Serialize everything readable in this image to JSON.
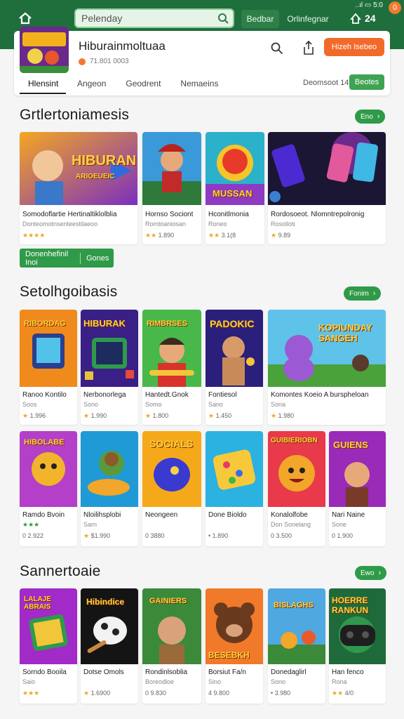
{
  "topbar": {
    "search_value": "Pelenday",
    "btn_primary": "Bedbar",
    "btn_secondary": "Orlinfegnar",
    "status_text": "..ıl ▭ 5:0",
    "badge": "0",
    "count": "24"
  },
  "app": {
    "title": "Hiburainmoltuaa",
    "rating_text": "71.801 0003",
    "install_label": "Hizeh Isebeo",
    "tabs": [
      "Hlensint",
      "Angeon",
      "Geodrent",
      "Nemaeins"
    ],
    "sort_label": "Deomsoot 14",
    "sort_button": "Beotes"
  },
  "sections": [
    {
      "title": "Grtlertoniamesis",
      "more": "Eno",
      "cards": [
        {
          "title": "Somodoflartie Hertinaltiklolblia",
          "subtitle": "Donteomotnsenteestilaeoo",
          "rating": "★★★★",
          "extra": ""
        },
        {
          "title": "Hornso Sociont",
          "subtitle": "Romtoaniosan",
          "rating": "★★",
          "extra": "1.890"
        },
        {
          "title": "Hconitlmonia",
          "subtitle": "Roneo",
          "rating": "★★",
          "extra": "3.1(8"
        },
        {
          "title": "Rordosoeot. Nlomntrepolronig",
          "subtitle": "Rosolloti",
          "rating": "★",
          "extra": "9.89"
        }
      ]
    },
    {
      "title": "Setolhgoibasis",
      "more": "Fonim",
      "cards": [
        {
          "title": "Ranoo Kontilo",
          "subtitle": "Soos",
          "rating": "★",
          "extra": "1.996"
        },
        {
          "title": "Nerbonorlega",
          "subtitle": "Sono",
          "rating": "★",
          "extra": "1.990"
        },
        {
          "title": "Hantedt.Gnok",
          "subtitle": "Somo",
          "rating": "★",
          "extra": "1.800"
        },
        {
          "title": "Fontiesol",
          "subtitle": "Sano",
          "rating": "★",
          "extra": "1.450"
        },
        {
          "title": "Komontes Koeio A burspheloan",
          "subtitle": "Sona",
          "rating": "★",
          "extra": "1.980"
        },
        {
          "title": "Ramdo Bvoin",
          "subtitle": "",
          "rating": "★★★",
          "extra": "0 2.922"
        },
        {
          "title": "Nloilihsplobi",
          "subtitle": "Sarn",
          "rating": "★",
          "extra": "$1.990"
        },
        {
          "title": "Neongeen",
          "subtitle": "",
          "rating": "",
          "extra": "0 3880"
        },
        {
          "title": "Done Bioldo",
          "subtitle": "",
          "rating": "",
          "extra": "• 1.890"
        },
        {
          "title": "Konalolfobe",
          "subtitle": "Don Sonelang",
          "rating": "",
          "extra": "0 3.500"
        },
        {
          "title": "Nari Naine",
          "subtitle": "Sone",
          "rating": "",
          "extra": "0 1.900"
        }
      ]
    },
    {
      "title": "Sannertoaie",
      "more": "Ewo",
      "cards": [
        {
          "title": "Sorndo Booila",
          "subtitle": "Saio",
          "rating": "★★★",
          "extra": ""
        },
        {
          "title": "Dotse Omols",
          "subtitle": "",
          "rating": "★",
          "extra": "1.6900"
        },
        {
          "title": "Rondinlsoblia",
          "subtitle": "Boreodloe",
          "rating": "",
          "extra": "0 9.830"
        },
        {
          "title": "Borsiut Fa/n",
          "subtitle": "Sino",
          "rating": "",
          "extra": "4 9.800"
        },
        {
          "title": "Donedaglirl",
          "subtitle": "Sono",
          "rating": "",
          "extra": "• 3.980"
        },
        {
          "title": "Han fenco",
          "subtitle": "Rona",
          "rating": "★★",
          "extra": "4/0"
        }
      ]
    }
  ],
  "row_button": {
    "left": "Donenhefinil Inoi",
    "right": "Gones"
  },
  "art": {
    "a1": "HIBURAN",
    "a1b": "ARIOEUEIC",
    "a3": "MUSSAN",
    "b1": "RIBORDAG",
    "b2": "HIBURAK",
    "b3": "RIMBRSES",
    "b4": "PADOKIC",
    "b5": "KOPIUNDAY SANGEH",
    "c1": "HIBOLABE",
    "c3": "SOCIALS",
    "c5": "GUIBIERIOBN",
    "c6": "GUIENS",
    "d1": "LALAJE ABRAIS",
    "d2": "Hibindice",
    "d3": "GAINIERS",
    "d4": "BESEBKH",
    "d5": "BISLAGHS",
    "d6": "HOERRE RANKUN"
  },
  "colors": {
    "brand_green": "#1f6f3c",
    "accent_green": "#2f9a48",
    "install_orange": "#f26a2a"
  }
}
